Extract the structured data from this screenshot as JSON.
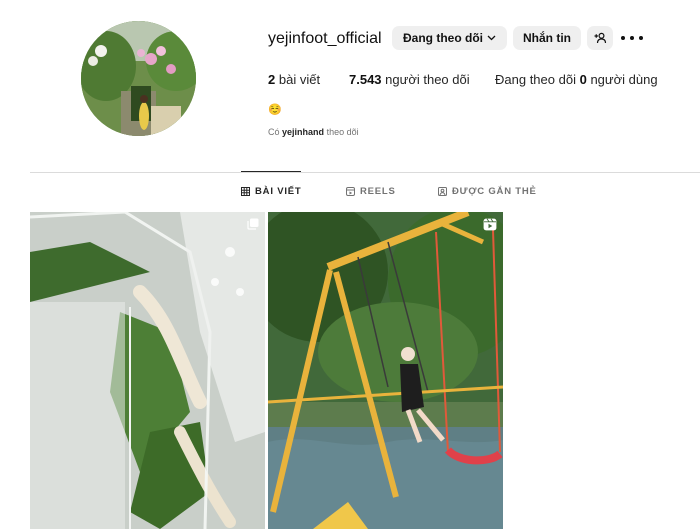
{
  "profile": {
    "username": "yejinfoot_official",
    "avatar": "profile-photo",
    "emoji": "☺️"
  },
  "actions": {
    "follow_label": "Đang theo dõi",
    "message_label": "Nhắn tin",
    "add_user_icon": "add-user-icon",
    "more_icon": "more-icon"
  },
  "stats": {
    "posts_count": "2",
    "posts_label": "bài viết",
    "followers_count": "7.543",
    "followers_label": "người theo dõi",
    "following_prefix": "Đang theo dõi",
    "following_count": "0",
    "following_suffix": "người dùng"
  },
  "followed_by": {
    "prefix": "Có",
    "user": "yejinhand",
    "suffix": "theo dõi"
  },
  "tabs": [
    {
      "label": "BÀI VIẾT",
      "icon": "grid-icon",
      "active": true
    },
    {
      "label": "REELS",
      "icon": "reels-icon",
      "active": false
    },
    {
      "label": "ĐƯỢC GẮN THẺ",
      "icon": "tagged-icon",
      "active": false
    }
  ],
  "posts": [
    {
      "type": "image",
      "badge": "multi-photo-icon"
    },
    {
      "type": "reel",
      "badge": "reel-icon"
    }
  ],
  "colors": {
    "button_bg": "#efefef",
    "text": "#262626",
    "muted": "#737373",
    "divider": "#dbdbdb"
  }
}
